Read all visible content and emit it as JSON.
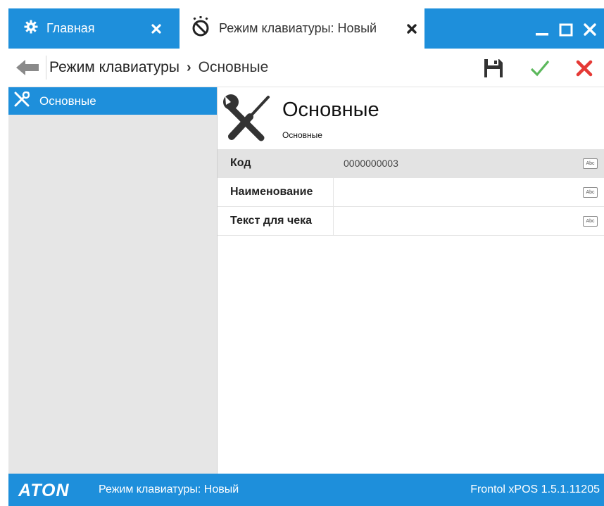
{
  "tabs": [
    {
      "label": "Главная",
      "icon": "gear-icon"
    },
    {
      "label": "Режим клавиатуры: Новый",
      "icon": "timer-off-icon"
    }
  ],
  "breadcrumb": {
    "parent": "Режим клавиатуры",
    "separator": "›",
    "current": "Основные"
  },
  "sidebar": {
    "items": [
      {
        "label": "Основные",
        "icon": "tools-icon"
      }
    ]
  },
  "main": {
    "title": "Основные",
    "subtitle": "Основные",
    "fields": [
      {
        "label": "Код",
        "value": "0000000003"
      },
      {
        "label": "Наименование",
        "value": ""
      },
      {
        "label": "Текст для чека",
        "value": ""
      }
    ],
    "abc_label": "Abc"
  },
  "statusbar": {
    "logo": "ATON",
    "mode": "Режим клавиатуры: Новый",
    "version": "Frontol xPOS 1.5.1.11205"
  },
  "colors": {
    "accent": "#1e8fdb",
    "save": "#333333",
    "apply": "#5cb85c",
    "cancel": "#e53935"
  }
}
